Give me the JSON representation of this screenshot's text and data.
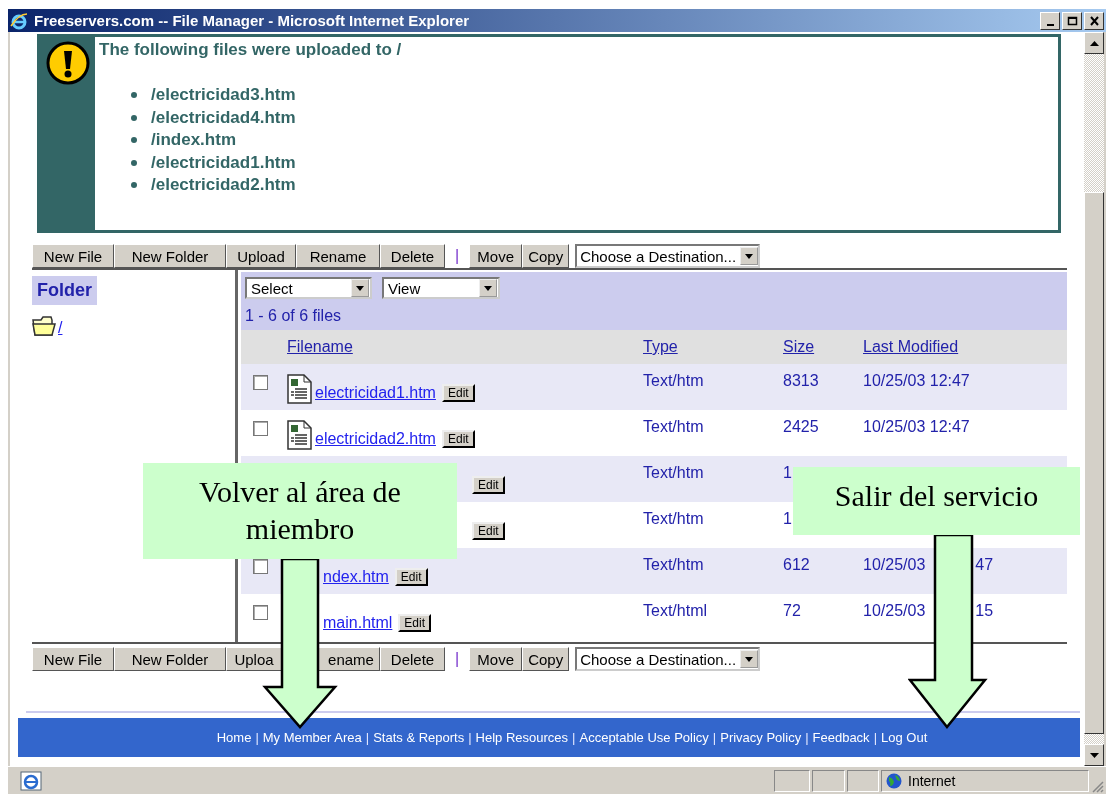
{
  "window": {
    "title": "Freeservers.com -- File Manager - Microsoft Internet Explorer"
  },
  "notice": {
    "message": "The following files were uploaded to /",
    "files": [
      "/electricidad3.htm",
      "/electricidad4.htm",
      "/index.htm",
      "/electricidad1.htm",
      "/electricidad2.htm"
    ]
  },
  "top_toolbar": {
    "items": [
      {
        "kind": "button",
        "label": "New File"
      },
      {
        "kind": "button",
        "label": "New Folder"
      },
      {
        "kind": "button",
        "label": "Upload"
      },
      {
        "kind": "button",
        "label": "Rename"
      },
      {
        "kind": "button",
        "label": "Delete"
      },
      {
        "kind": "separator",
        "label": "|"
      },
      {
        "kind": "button",
        "label": "Move"
      },
      {
        "kind": "button",
        "label": "Copy"
      },
      {
        "kind": "dropdown",
        "label": "Choose a Destination..."
      }
    ]
  },
  "folder_pane": {
    "title": "Folder",
    "items": [
      {
        "label": "/"
      }
    ]
  },
  "file_list": {
    "select": "Select",
    "view": "View",
    "count": "1 - 6 of 6 files",
    "columns": [
      "Filename",
      "Type",
      "Size",
      "Last Modified"
    ],
    "rows": [
      {
        "checked": false,
        "file_icon": true,
        "filename": "electricidad1.htm",
        "edit": "Edit",
        "type": "Text/htm",
        "size": "8313",
        "modified": [
          "10/25/03 12:47"
        ]
      },
      {
        "checked": false,
        "file_icon": true,
        "filename": "electricidad2.htm",
        "edit": "Edit",
        "type": "Text/htm",
        "size": "2425",
        "modified": [
          "10/25/03 12:47"
        ]
      },
      {
        "file_icon": false,
        "edit": "Edit",
        "type": "Text/htm",
        "size": "1",
        "modified": []
      },
      {
        "file_icon": false,
        "edit": "Edit",
        "type": "Text/htm",
        "size": "1",
        "modified": []
      },
      {
        "checked": false,
        "file_icon": false,
        "filename": "ndex.htm",
        "edit": "Edit",
        "type": "Text/htm",
        "size": "612",
        "modified": [
          "10/25/03",
          "47"
        ]
      },
      {
        "checked": false,
        "file_icon": false,
        "filename": "main.html",
        "edit": "Edit",
        "type": "Text/html",
        "size": "72",
        "modified": [
          "10/25/03",
          "15"
        ]
      }
    ]
  },
  "bottom_toolbar": {
    "items": [
      {
        "kind": "button",
        "label": "New File"
      },
      {
        "kind": "button",
        "label": "New Folder"
      },
      {
        "kind": "button",
        "label": "Uploa"
      },
      {
        "kind": "button",
        "label": "ename"
      },
      {
        "kind": "button",
        "label": "Delete"
      },
      {
        "kind": "separator",
        "label": "|"
      },
      {
        "kind": "button",
        "label": "Move"
      },
      {
        "kind": "button",
        "label": "Copy"
      },
      {
        "kind": "dropdown",
        "label": "Choose a Destination..."
      }
    ]
  },
  "footer": {
    "items": [
      {
        "kind": "link",
        "text": "Home"
      },
      {
        "kind": "separator",
        "text": "|"
      },
      {
        "kind": "link",
        "text": "My Member Area"
      },
      {
        "kind": "separator",
        "text": "|"
      },
      {
        "kind": "link",
        "text": "Stats & Reports"
      },
      {
        "kind": "separator",
        "text": "|"
      },
      {
        "kind": "link",
        "text": "Help Resources"
      },
      {
        "kind": "separator",
        "text": "|"
      },
      {
        "kind": "link",
        "text": "Acceptable Use Policy"
      },
      {
        "kind": "separator",
        "text": "|"
      },
      {
        "kind": "link",
        "text": "Privacy Policy"
      },
      {
        "kind": "separator",
        "text": "|"
      },
      {
        "kind": "link",
        "text": "Feedback"
      },
      {
        "kind": "separator",
        "text": "|"
      },
      {
        "kind": "link",
        "text": "Log Out"
      }
    ]
  },
  "status_bar": {
    "zone": "Internet"
  },
  "callouts": [
    {
      "text": "Volver al área de miembro"
    },
    {
      "text": "Salir del servicio"
    }
  ]
}
